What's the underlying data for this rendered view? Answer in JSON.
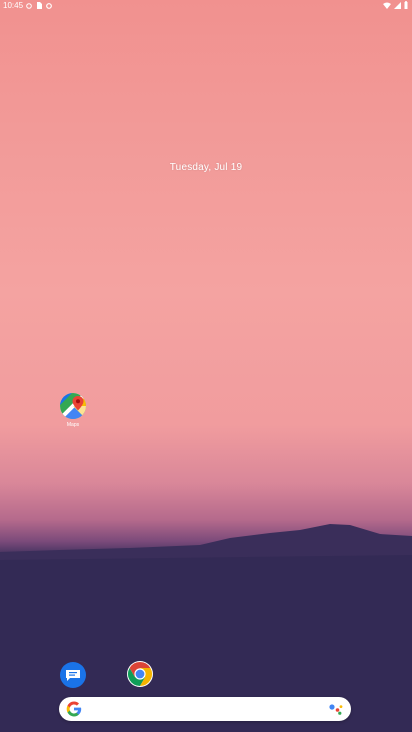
{
  "statusbar": {
    "time": "10:45",
    "left_icons": [
      "notification-dot-icon",
      "sim-card-icon",
      "data-saver-icon"
    ],
    "right_icons": [
      "wifi-icon",
      "signal-icon",
      "battery-icon"
    ]
  },
  "homescreen": {
    "date": "Tuesday, Jul 19",
    "apps": [
      {
        "name": "maps-app",
        "label": "Maps",
        "icon": "google-maps-icon"
      }
    ],
    "dock": [
      {
        "name": "messages-app",
        "icon": "messages-icon"
      },
      {
        "name": "chrome-app",
        "icon": "chrome-icon"
      }
    ],
    "search": {
      "left_icon": "google-g-icon",
      "right_icon": "assistant-icon"
    }
  },
  "colors": {
    "sky_top": "#f1918f",
    "sky_mid": "#f4a3a1",
    "horizon": "#b56a8c",
    "ground": "#2f2a4f"
  }
}
